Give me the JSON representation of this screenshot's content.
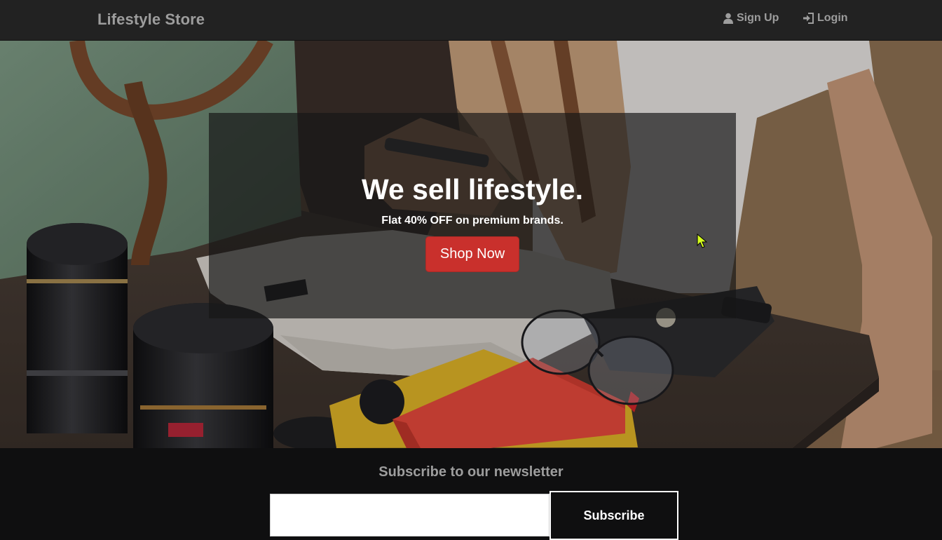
{
  "navbar": {
    "brand": "Lifestyle Store",
    "links": [
      {
        "label": "Sign Up",
        "icon": "user-icon"
      },
      {
        "label": "Login",
        "icon": "login-icon"
      }
    ]
  },
  "hero": {
    "title": "We sell lifestyle.",
    "subtitle": "Flat 40% OFF on premium brands.",
    "button_label": "Shop Now",
    "background": "photo of a table with camera lenses, a red notebook, a wallet, sunglasses and clothes",
    "button_color": "#c9302c"
  },
  "newsletter": {
    "title": "Subscribe to our newsletter",
    "input_value": "",
    "button_label": "Subscribe"
  },
  "colors": {
    "navbar_bg": "#222222",
    "nav_text": "#9d9d9d",
    "footer_bg": "#0f0f10",
    "cursor": "#d6ff1e"
  }
}
